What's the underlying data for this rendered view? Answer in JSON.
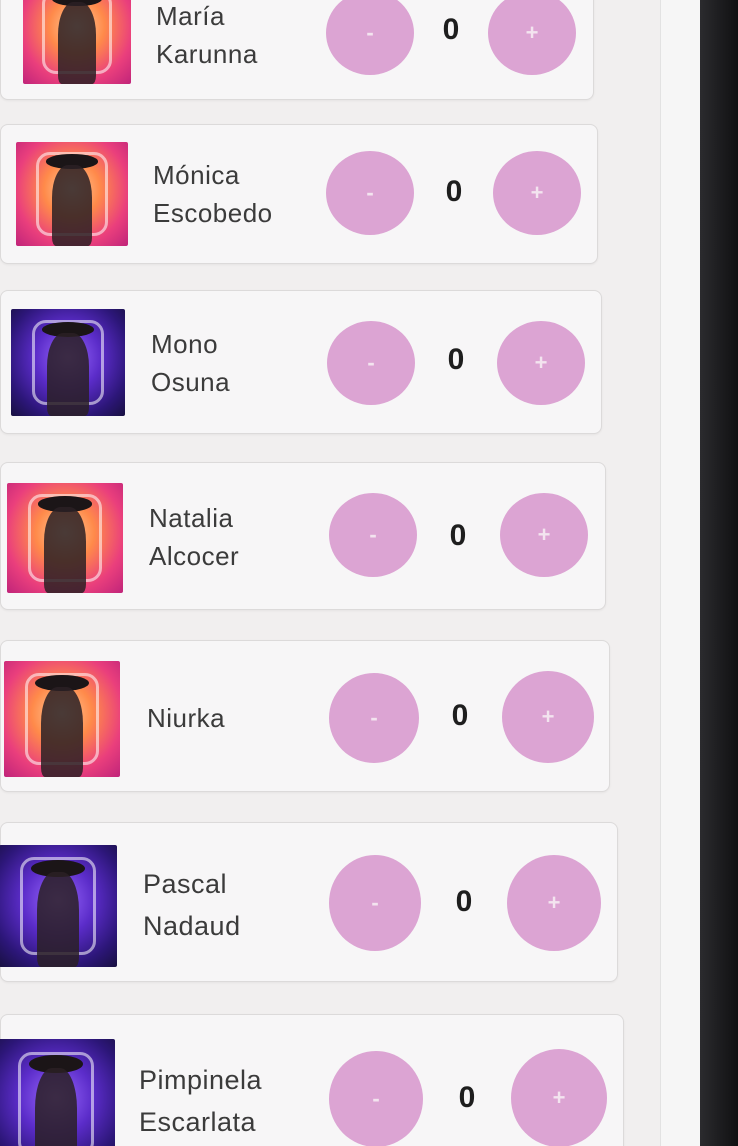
{
  "contestants": [
    {
      "first": "María",
      "last": "Karunna",
      "count": "0",
      "theme": "warm"
    },
    {
      "first": "Mónica",
      "last": "Escobedo",
      "count": "0",
      "theme": "warm"
    },
    {
      "first": "Mono",
      "last": "Osuna",
      "count": "0",
      "theme": "cool"
    },
    {
      "first": "Natalia",
      "last": "Alcocer",
      "count": "0",
      "theme": "warm"
    },
    {
      "first": "Niurka",
      "last": "",
      "count": "0",
      "theme": "warm"
    },
    {
      "first": "Pascal",
      "last": "Nadaud",
      "count": "0",
      "theme": "cool"
    },
    {
      "first": "Pimpinela",
      "last": "Escarlata",
      "count": "0",
      "theme": "cool"
    }
  ],
  "controls": {
    "minus_label": "-",
    "plus_label": "+"
  },
  "colors": {
    "button": "#dca4d3",
    "card": "#f7f6f7",
    "background": "#f1efef"
  }
}
